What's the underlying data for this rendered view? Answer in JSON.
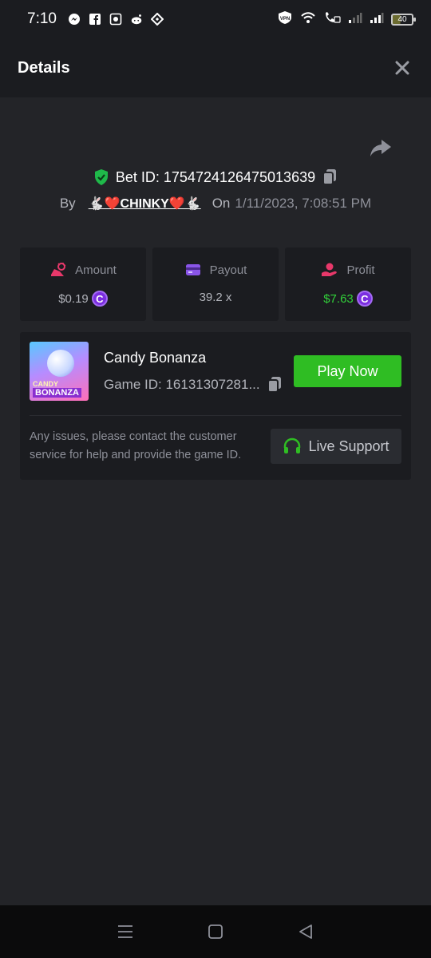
{
  "status_bar": {
    "time": "7:10",
    "battery": "40",
    "app_icons": [
      "messenger-icon",
      "facebook-icon",
      "gallery-icon",
      "reddit-icon",
      "binance-icon"
    ],
    "system_icons": [
      "vpn-icon",
      "wifi-icon",
      "volte-icon",
      "signal-icon",
      "signal-icon"
    ]
  },
  "header": {
    "title": "Details"
  },
  "bet": {
    "bet_id_label": "Bet ID: 1754724126475013639",
    "by_label": "By",
    "username": "🐇❤️CHINKY❤️🐇",
    "on_label": "On",
    "date": "1/11/2023, 7:08:51 PM"
  },
  "stats": {
    "amount": {
      "label": "Amount",
      "value": "$0.19"
    },
    "payout": {
      "label": "Payout",
      "value": "39.2 x"
    },
    "profit": {
      "label": "Profit",
      "value": "$7.63"
    }
  },
  "coin_symbol": "C",
  "game": {
    "thumb_line1": "CANDY",
    "thumb_line2": "BONANZA",
    "title": "Candy Bonanza",
    "game_id": "Game ID: 16131307281...",
    "play_label": "Play Now",
    "issue_text": "Any issues, please contact the customer service for help and provide the game ID.",
    "support_label": "Live Support"
  },
  "colors": {
    "background": "#232428",
    "panel": "#1b1c20",
    "accent_green": "#2fbd23",
    "profit_green": "#32d23a",
    "coin_purple": "#7b2ee0"
  }
}
